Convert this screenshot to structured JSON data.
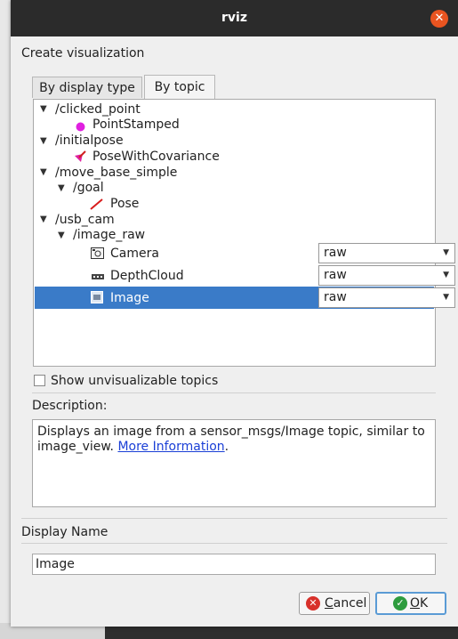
{
  "window": {
    "title": "rviz",
    "close_glyph": "✕"
  },
  "header": {
    "create_label": "Create visualization"
  },
  "tabs": [
    {
      "label": "By display type",
      "active": false
    },
    {
      "label": "By topic",
      "active": true
    }
  ],
  "tree": {
    "clicked_point": {
      "topic": "/clicked_point",
      "child": "PointStamped",
      "child_icon": "magenta-dot-icon"
    },
    "initialpose": {
      "topic": "/initialpose",
      "child": "PoseWithCovariance",
      "child_icon": "pose-covariance-icon"
    },
    "move_base_simple": {
      "topic": "/move_base_simple",
      "sub": "/goal",
      "child": "Pose",
      "child_icon": "red-arrow-icon"
    },
    "usb_cam": {
      "topic": "/usb_cam",
      "sub": "/image_raw",
      "items": [
        {
          "label": "Camera",
          "icon": "camera-icon",
          "transport": "raw"
        },
        {
          "label": "DepthCloud",
          "icon": "depthcloud-icon",
          "transport": "raw"
        },
        {
          "label": "Image",
          "icon": "image-icon",
          "transport": "raw",
          "selected": true
        }
      ]
    }
  },
  "show_unvisualizable": {
    "label": "Show unvisualizable topics",
    "checked": false
  },
  "description": {
    "label": "Description:",
    "text": "Displays an image from a sensor_msgs/Image topic, similar to image_view.",
    "link": "More Information",
    "trailing": "."
  },
  "display_name": {
    "label": "Display Name",
    "value": "Image"
  },
  "buttons": {
    "cancel": {
      "label_mnemonic": "C",
      "label_rest": "ancel"
    },
    "ok": {
      "label_mnemonic": "O",
      "label_rest": "K"
    }
  },
  "colors": {
    "accent": "#3a7bc8",
    "titlebar": "#2b2b2b",
    "close": "#e95420",
    "link": "#1a3fd6"
  }
}
